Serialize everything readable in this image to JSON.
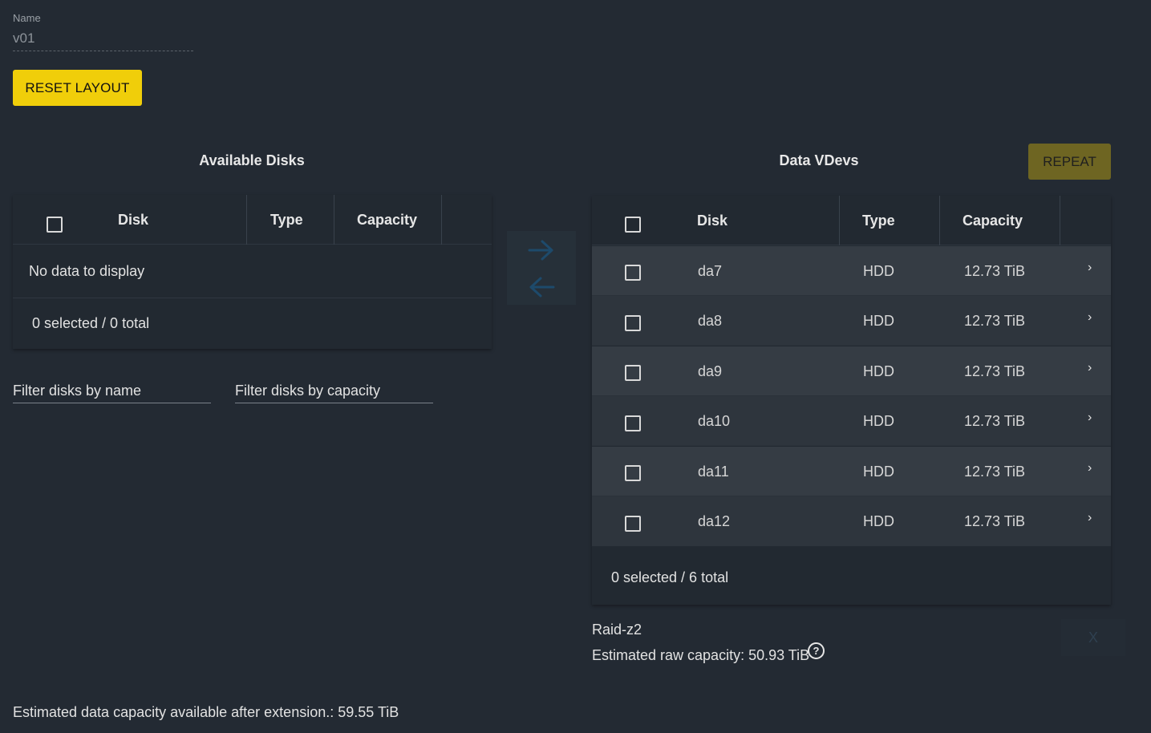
{
  "name_field": {
    "label": "Name",
    "value": "v01"
  },
  "reset_button": "RESET LAYOUT",
  "available": {
    "title": "Available Disks",
    "columns": {
      "disk": "Disk",
      "type": "Type",
      "capacity": "Capacity"
    },
    "empty": "No data to display",
    "footer": "0 selected / 0 total",
    "filter_name_placeholder": "Filter disks by name",
    "filter_capacity_placeholder": "Filter disks by capacity"
  },
  "vdevs": {
    "title": "Data VDevs",
    "repeat_button": "REPEAT",
    "columns": {
      "disk": "Disk",
      "type": "Type",
      "capacity": "Capacity"
    },
    "rows": [
      {
        "disk": "da7",
        "type": "HDD",
        "capacity": "12.73 TiB"
      },
      {
        "disk": "da8",
        "type": "HDD",
        "capacity": "12.73 TiB"
      },
      {
        "disk": "da9",
        "type": "HDD",
        "capacity": "12.73 TiB"
      },
      {
        "disk": "da10",
        "type": "HDD",
        "capacity": "12.73 TiB"
      },
      {
        "disk": "da11",
        "type": "HDD",
        "capacity": "12.73 TiB"
      },
      {
        "disk": "da12",
        "type": "HDD",
        "capacity": "12.73 TiB"
      }
    ],
    "footer": "0 selected / 6 total",
    "raid_type": "Raid-z2",
    "raw_capacity": "Estimated raw capacity: 50.93 TiB",
    "close_label": "X"
  },
  "estimated_capacity": "Estimated data capacity available after extension.: 59.55 TiB",
  "colors": {
    "accent": "#f0ce0a",
    "background": "#232a33",
    "arrow": "#1d4a6b"
  }
}
